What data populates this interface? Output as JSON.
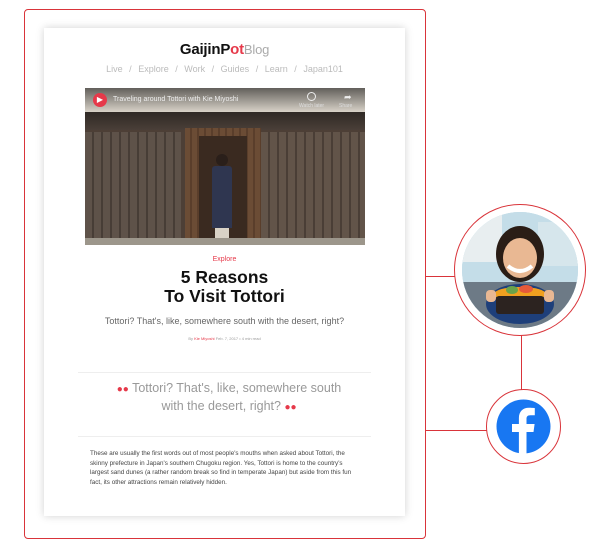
{
  "blog": {
    "logo_main": "GaijinP",
    "logo_accent": "ot",
    "logo_suffix": "Blog",
    "nav": [
      "Live",
      "/",
      "Explore",
      "/",
      "Work",
      "/",
      "Guides",
      "/",
      "Learn",
      "/",
      "Japan101"
    ]
  },
  "video": {
    "title": "Traveling around Tottori with Kie Miyoshi",
    "watch_later": "Watch later",
    "share": "Share"
  },
  "article": {
    "category": "Explore",
    "title_line1": "5 Reasons",
    "title_line2": "To Visit Tottori",
    "subtitle": "Tottori? That's, like, somewhere south with the desert, right?",
    "byline_prefix": "By",
    "author": "Kie Miyoshi",
    "byline_meta": "Feb. 7, 2017 • 4 min read",
    "pull_quote": "Tottori? That's, like, somewhere south with the desert, right?",
    "body_text": "These are usually the first words out of most people's mouths when asked about Tottori, the skinny prefecture in Japan's southern Chugoku region. Yes, Tottori is home to the country's largest sand dunes (a rather random break so find in temperate Japan) but aside from this fun fact, its other attractions remain relatively hidden."
  },
  "colors": {
    "accent": "#e6394a",
    "facebook": "#1877f2",
    "frame_line": "#d9343a"
  }
}
